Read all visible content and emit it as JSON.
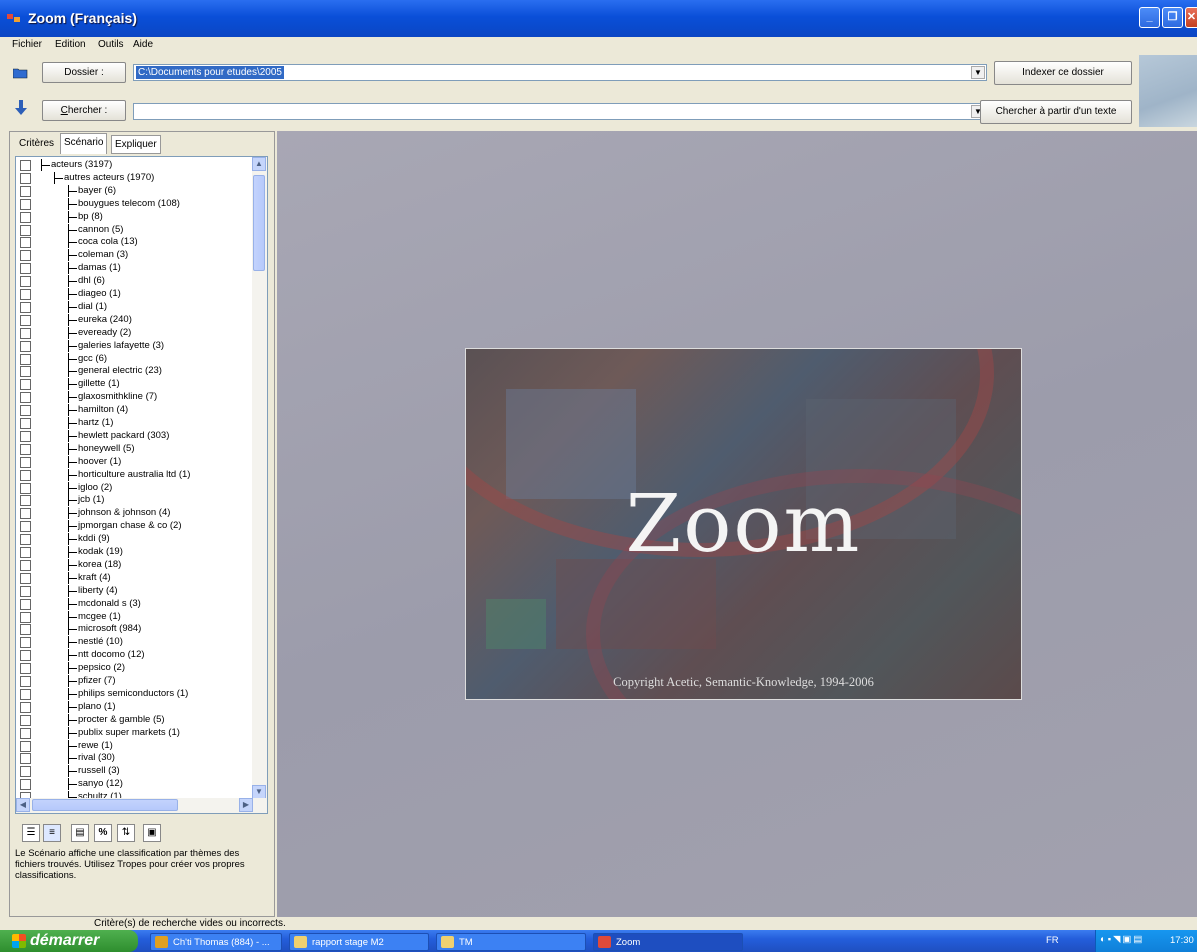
{
  "window": {
    "title": "Zoom (Français)"
  },
  "menu": [
    "Fichier",
    "Edition",
    "Outils",
    "Aide"
  ],
  "toolbar": {
    "folder_label": "Dossier :",
    "folder_value": "C:\\Documents pour etudes\\2005",
    "index_button": "Indexer ce dossier",
    "search_label": "Chercher :",
    "search_value": "",
    "search_text_button": "Chercher à partir d'un texte"
  },
  "left_tabs": [
    "Critères",
    "Scénario",
    "Expliquer"
  ],
  "active_tab": "Scénario",
  "tree": {
    "root": "acteurs (3197)",
    "group": "autres acteurs (1970)",
    "items": [
      "bayer (6)",
      "bouygues telecom (108)",
      "bp (8)",
      "cannon (5)",
      "coca cola (13)",
      "coleman (3)",
      "damas (1)",
      "dhl (6)",
      "diageo (1)",
      "dial (1)",
      "eureka (240)",
      "eveready (2)",
      "galeries lafayette (3)",
      "gcc (6)",
      "general electric (23)",
      "gillette (1)",
      "glaxosmithkline (7)",
      "hamilton (4)",
      "hartz (1)",
      "hewlett packard (303)",
      "honeywell (5)",
      "hoover (1)",
      "horticulture australia ltd (1)",
      "igloo (2)",
      "jcb (1)",
      "johnson & johnson (4)",
      "jpmorgan chase & co (2)",
      "kddi (9)",
      "kodak (19)",
      "korea (18)",
      "kraft (4)",
      "liberty (4)",
      "mcdonald s (3)",
      "mcgee (1)",
      "microsoft (984)",
      "nestlé (10)",
      "ntt docomo (12)",
      "pepsico (2)",
      "pfizer (7)",
      "philips semiconductors (1)",
      "plano (1)",
      "procter & gamble (5)",
      "publix super markets (1)",
      "rewe (1)",
      "rival (30)",
      "russell (3)",
      "sanyo (12)",
      "schultz (1)"
    ]
  },
  "description": "Le Scénario affiche une classification par thèmes des fichiers trouvés. Utilisez Tropes pour créer vos propres classifications.",
  "splash": {
    "title": "Zoom",
    "copyright": "Copyright Acetic, Semantic-Knowledge, 1994-2006"
  },
  "status": "Critère(s) de recherche vides ou incorrects.",
  "taskbar": {
    "start": "démarrer",
    "items": [
      "Ch'ti Thomas (884) - ...",
      "rapport stage M2",
      "TM",
      "Zoom"
    ],
    "lang": "FR",
    "clock": "17:30"
  }
}
